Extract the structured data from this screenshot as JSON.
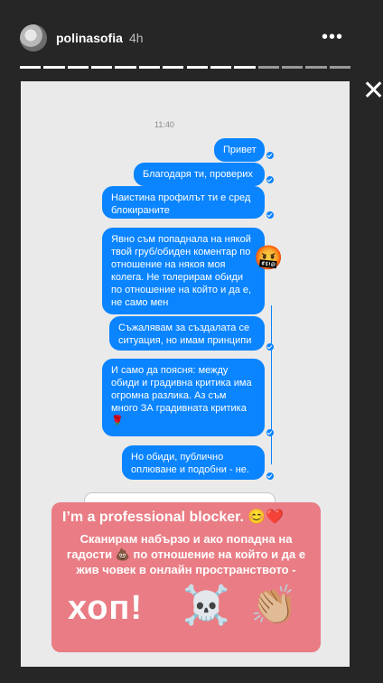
{
  "header": {
    "username": "polinasofia",
    "time": "4h",
    "more_icon": "more-options-icon",
    "close_icon": "close-icon",
    "progress": {
      "segments": 14,
      "viewed": 10
    }
  },
  "chat": {
    "timestamp": "11:40",
    "messages": [
      "Привет",
      "Благодаря ти, проверих",
      "Наистина профилът ти е сред блокираните",
      "Явно съм попаднала на някой твой груб/обиден коментар по отношение на някоя моя колега. Не толерирам обиди по отношение на който и да е, не само мен",
      "Съжалявам за създалата се ситуация, но имам принципи",
      "И само да поясня: между обиди и градивна критика има огромна разлика. Аз съм много ЗА градивната критика",
      "Но обиди, публично оплюване и подобни - не."
    ],
    "angry_emoji": "🤬",
    "rose_emoji": "🌹",
    "accent_color": "#0a84ff"
  },
  "overlay": {
    "line1": "I’m a professional blocker.",
    "line1_emojis": "😊❤️",
    "line2": "Сканирам набързо и ако попадна на гадости 💩 по отношение на който и да е жив човек в онлайн пространството -",
    "big_text": "хоп!",
    "skull_emoji": "☠️",
    "clap_emoji": "👏🏼",
    "bg_color": "#e97c84"
  }
}
